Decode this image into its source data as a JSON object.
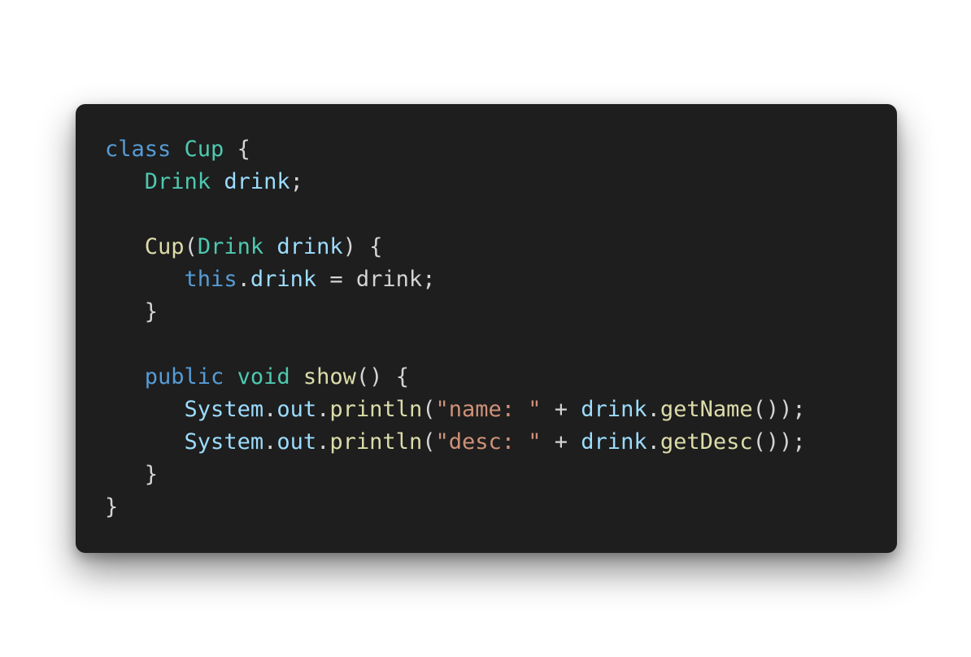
{
  "code_snippet": {
    "language": "java",
    "colors": {
      "background": "#1e1e1e",
      "keyword": "#569cd6",
      "type": "#4ec9b0",
      "variable": "#9cdcfe",
      "function": "#dcdcaa",
      "string": "#ce9178",
      "punctuation": "#d4d4d4"
    },
    "lines": [
      [
        {
          "t": "class",
          "k": "keyword"
        },
        {
          "t": " ",
          "k": "plain"
        },
        {
          "t": "Cup",
          "k": "type"
        },
        {
          "t": " {",
          "k": "punc"
        }
      ],
      [
        {
          "t": "   ",
          "k": "plain"
        },
        {
          "t": "Drink",
          "k": "type"
        },
        {
          "t": " ",
          "k": "plain"
        },
        {
          "t": "drink",
          "k": "var"
        },
        {
          "t": ";",
          "k": "punc"
        }
      ],
      [],
      [
        {
          "t": "   ",
          "k": "plain"
        },
        {
          "t": "Cup",
          "k": "fn"
        },
        {
          "t": "(",
          "k": "punc"
        },
        {
          "t": "Drink",
          "k": "type"
        },
        {
          "t": " ",
          "k": "plain"
        },
        {
          "t": "drink",
          "k": "var"
        },
        {
          "t": ") {",
          "k": "punc"
        }
      ],
      [
        {
          "t": "      ",
          "k": "plain"
        },
        {
          "t": "this",
          "k": "keyword"
        },
        {
          "t": ".",
          "k": "punc"
        },
        {
          "t": "drink",
          "k": "var"
        },
        {
          "t": " = ",
          "k": "punc"
        },
        {
          "t": "drink",
          "k": "plain"
        },
        {
          "t": ";",
          "k": "punc"
        }
      ],
      [
        {
          "t": "   ",
          "k": "plain"
        },
        {
          "t": "}",
          "k": "punc"
        }
      ],
      [],
      [
        {
          "t": "   ",
          "k": "plain"
        },
        {
          "t": "public",
          "k": "keyword"
        },
        {
          "t": " ",
          "k": "plain"
        },
        {
          "t": "void",
          "k": "type"
        },
        {
          "t": " ",
          "k": "plain"
        },
        {
          "t": "show",
          "k": "fn"
        },
        {
          "t": "() {",
          "k": "punc"
        }
      ],
      [
        {
          "t": "      ",
          "k": "plain"
        },
        {
          "t": "System",
          "k": "var"
        },
        {
          "t": ".",
          "k": "punc"
        },
        {
          "t": "out",
          "k": "var"
        },
        {
          "t": ".",
          "k": "punc"
        },
        {
          "t": "println",
          "k": "fn"
        },
        {
          "t": "(",
          "k": "punc"
        },
        {
          "t": "\"name: \"",
          "k": "str"
        },
        {
          "t": " + ",
          "k": "punc"
        },
        {
          "t": "drink",
          "k": "var"
        },
        {
          "t": ".",
          "k": "punc"
        },
        {
          "t": "getName",
          "k": "fn"
        },
        {
          "t": "());",
          "k": "punc"
        }
      ],
      [
        {
          "t": "      ",
          "k": "plain"
        },
        {
          "t": "System",
          "k": "var"
        },
        {
          "t": ".",
          "k": "punc"
        },
        {
          "t": "out",
          "k": "var"
        },
        {
          "t": ".",
          "k": "punc"
        },
        {
          "t": "println",
          "k": "fn"
        },
        {
          "t": "(",
          "k": "punc"
        },
        {
          "t": "\"desc: \"",
          "k": "str"
        },
        {
          "t": " + ",
          "k": "punc"
        },
        {
          "t": "drink",
          "k": "var"
        },
        {
          "t": ".",
          "k": "punc"
        },
        {
          "t": "getDesc",
          "k": "fn"
        },
        {
          "t": "());",
          "k": "punc"
        }
      ],
      [
        {
          "t": "   ",
          "k": "plain"
        },
        {
          "t": "}",
          "k": "punc"
        }
      ],
      [
        {
          "t": "}",
          "k": "punc"
        }
      ]
    ]
  }
}
